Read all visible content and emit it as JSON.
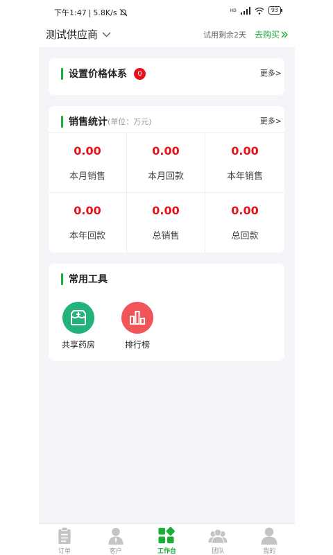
{
  "status_bar": {
    "time": "下午1:47",
    "speed": "5.8K/s",
    "battery": "93",
    "network": "HD"
  },
  "header": {
    "supplier": "测试供应商",
    "trial": "试用剩余2天",
    "buy": "去购买"
  },
  "price_card": {
    "title": "设置价格体系",
    "badge": "0",
    "more": "更多>"
  },
  "sales_card": {
    "title": "销售统计",
    "unit": "(单位：万元)",
    "more": "更多>",
    "stats": [
      {
        "value": "0.00",
        "label": "本月销售"
      },
      {
        "value": "0.00",
        "label": "本月回款"
      },
      {
        "value": "0.00",
        "label": "本年销售"
      },
      {
        "value": "0.00",
        "label": "本年回款"
      },
      {
        "value": "0.00",
        "label": "总销售"
      },
      {
        "value": "0.00",
        "label": "总回款"
      }
    ]
  },
  "tools_card": {
    "title": "常用工具",
    "tools": [
      {
        "label": "共享药房",
        "icon": "pharmacy-icon",
        "color": "#22b37a"
      },
      {
        "label": "排行榜",
        "icon": "ranking-icon",
        "color": "#f0555a"
      }
    ]
  },
  "bottom_nav": {
    "active_color": "#1aad37",
    "items": [
      {
        "label": "订单",
        "icon": "order-icon"
      },
      {
        "label": "客户",
        "icon": "customer-icon"
      },
      {
        "label": "工作台",
        "icon": "workbench-icon"
      },
      {
        "label": "团队",
        "icon": "team-icon"
      },
      {
        "label": "我的",
        "icon": "profile-icon"
      }
    ]
  }
}
